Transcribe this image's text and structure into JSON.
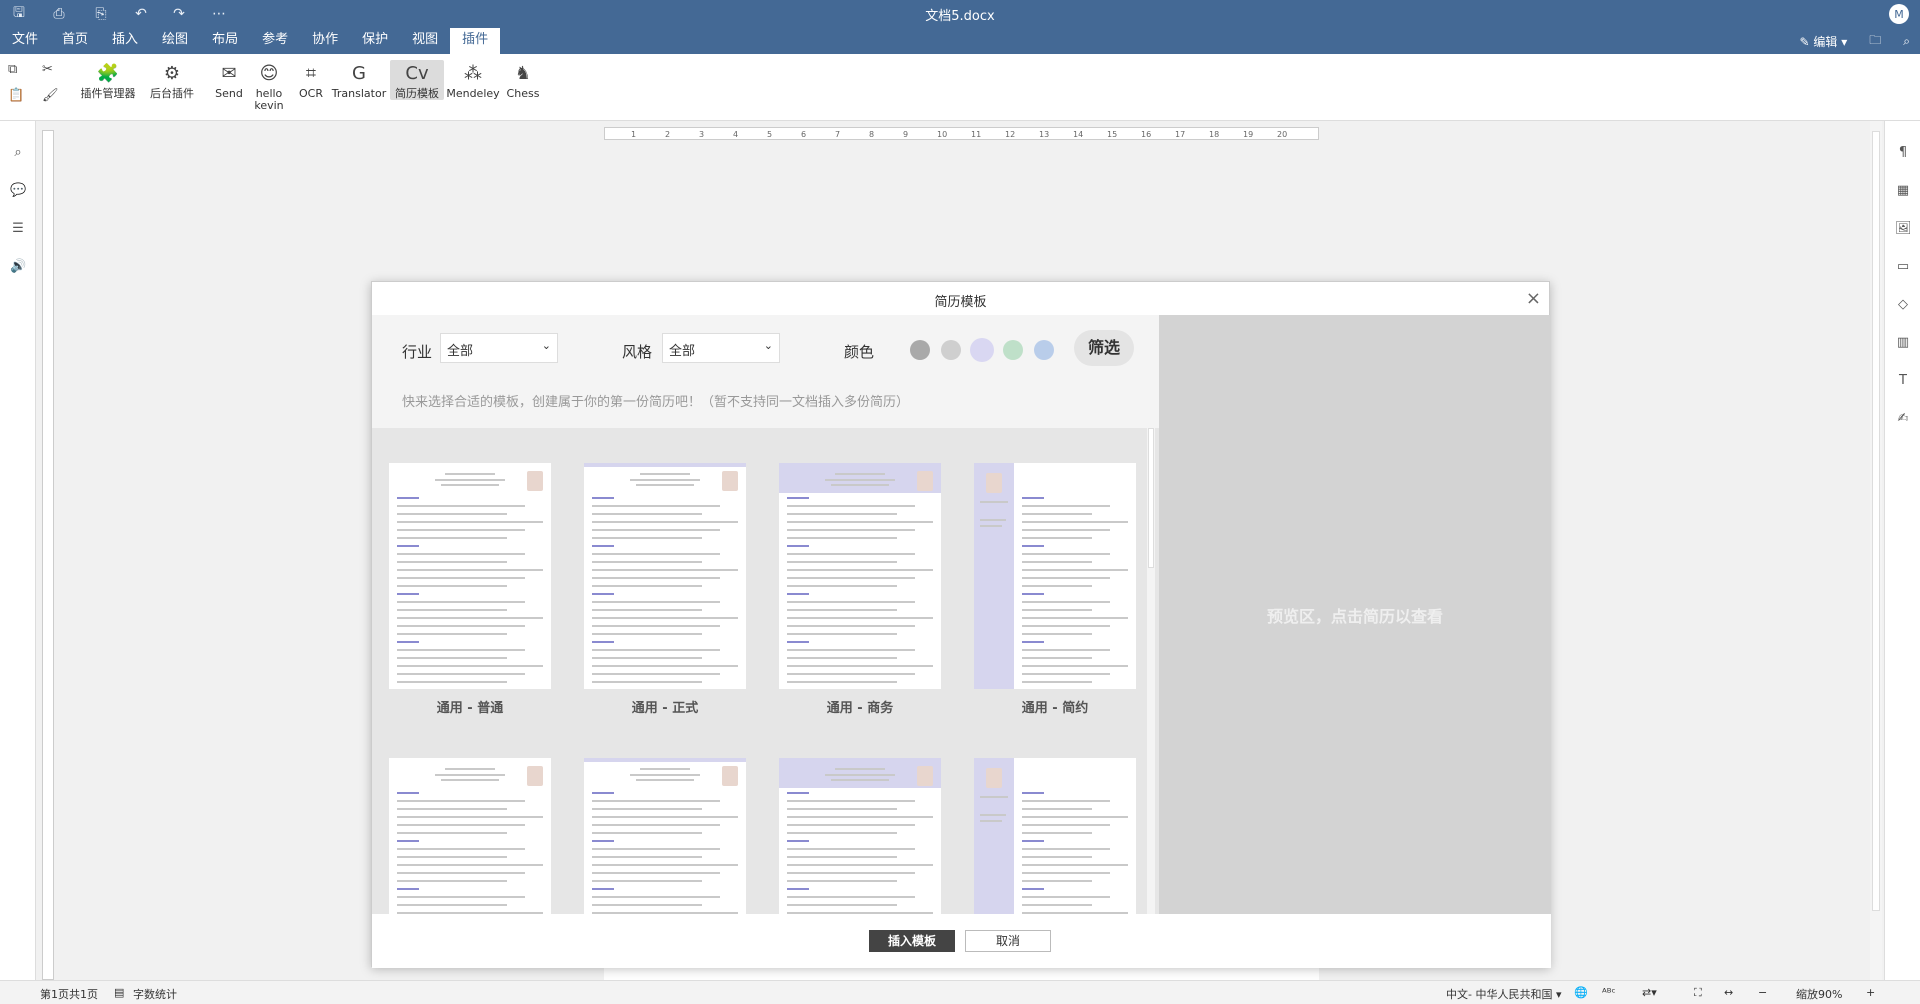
{
  "app": {
    "title": "文档5.docx",
    "avatar": "M"
  },
  "menu": {
    "tabs": [
      "文件",
      "首页",
      "插入",
      "绘图",
      "布局",
      "参考",
      "协作",
      "保护",
      "视图",
      "插件"
    ],
    "active": "插件",
    "edit_mode": "编辑"
  },
  "ribbon": {
    "buttons": [
      {
        "name": "plugin-manager",
        "label": "插件管理器"
      },
      {
        "name": "background-plugins",
        "label": "后台插件"
      },
      {
        "name": "send",
        "label": "Send"
      },
      {
        "name": "hello-kevin",
        "label": "hello kevin"
      },
      {
        "name": "ocr",
        "label": "OCR"
      },
      {
        "name": "translator",
        "label": "Translator"
      },
      {
        "name": "resume-templates",
        "label": "简历模板"
      },
      {
        "name": "mendeley",
        "label": "Mendeley"
      },
      {
        "name": "chess",
        "label": "Chess"
      }
    ]
  },
  "ruler": {
    "ticks": [
      "1",
      "2",
      "3",
      "4",
      "5",
      "6",
      "7",
      "8",
      "9",
      "10",
      "11",
      "12",
      "13",
      "14",
      "15",
      "16",
      "17",
      "18",
      "19",
      "20"
    ]
  },
  "dialog": {
    "title": "简历模板",
    "industry_label": "行业",
    "industry_value": "全部",
    "style_label": "风格",
    "style_value": "全部",
    "color_label": "颜色",
    "colors": [
      "#a9a9a9",
      "#cfcfcf",
      "#d9d7f2",
      "#bfe0c9",
      "#b9cdea"
    ],
    "filter_button": "筛选",
    "hint": "快来选择合适的模板，创建属于你的第一份简历吧！（暂不支持同一文档插入多份简历）",
    "preview_text": "预览区，点击简历以查看",
    "templates": [
      {
        "label": "通用 - 普通",
        "style": "plain"
      },
      {
        "label": "通用 - 正式",
        "style": "formal"
      },
      {
        "label": "通用 - 商务",
        "style": "business"
      },
      {
        "label": "通用 - 简约",
        "style": "simple"
      },
      {
        "label": "",
        "style": "plain"
      },
      {
        "label": "",
        "style": "formal"
      },
      {
        "label": "",
        "style": "business"
      },
      {
        "label": "",
        "style": "simple"
      }
    ],
    "insert_button": "插入模板",
    "cancel_button": "取消"
  },
  "status": {
    "page": "第1页共1页",
    "word_count": "字数统计",
    "language": "中文- 中华人民共和国",
    "zoom": "缩放90%"
  }
}
